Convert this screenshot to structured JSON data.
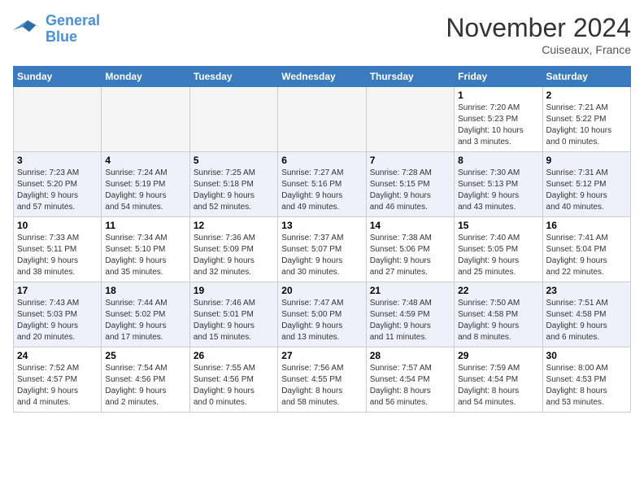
{
  "header": {
    "logo_line1": "General",
    "logo_line2": "Blue",
    "month": "November 2024",
    "location": "Cuiseaux, France"
  },
  "weekdays": [
    "Sunday",
    "Monday",
    "Tuesday",
    "Wednesday",
    "Thursday",
    "Friday",
    "Saturday"
  ],
  "weeks": [
    [
      {
        "day": "",
        "info": ""
      },
      {
        "day": "",
        "info": ""
      },
      {
        "day": "",
        "info": ""
      },
      {
        "day": "",
        "info": ""
      },
      {
        "day": "",
        "info": ""
      },
      {
        "day": "1",
        "info": "Sunrise: 7:20 AM\nSunset: 5:23 PM\nDaylight: 10 hours\nand 3 minutes."
      },
      {
        "day": "2",
        "info": "Sunrise: 7:21 AM\nSunset: 5:22 PM\nDaylight: 10 hours\nand 0 minutes."
      }
    ],
    [
      {
        "day": "3",
        "info": "Sunrise: 7:23 AM\nSunset: 5:20 PM\nDaylight: 9 hours\nand 57 minutes."
      },
      {
        "day": "4",
        "info": "Sunrise: 7:24 AM\nSunset: 5:19 PM\nDaylight: 9 hours\nand 54 minutes."
      },
      {
        "day": "5",
        "info": "Sunrise: 7:25 AM\nSunset: 5:18 PM\nDaylight: 9 hours\nand 52 minutes."
      },
      {
        "day": "6",
        "info": "Sunrise: 7:27 AM\nSunset: 5:16 PM\nDaylight: 9 hours\nand 49 minutes."
      },
      {
        "day": "7",
        "info": "Sunrise: 7:28 AM\nSunset: 5:15 PM\nDaylight: 9 hours\nand 46 minutes."
      },
      {
        "day": "8",
        "info": "Sunrise: 7:30 AM\nSunset: 5:13 PM\nDaylight: 9 hours\nand 43 minutes."
      },
      {
        "day": "9",
        "info": "Sunrise: 7:31 AM\nSunset: 5:12 PM\nDaylight: 9 hours\nand 40 minutes."
      }
    ],
    [
      {
        "day": "10",
        "info": "Sunrise: 7:33 AM\nSunset: 5:11 PM\nDaylight: 9 hours\nand 38 minutes."
      },
      {
        "day": "11",
        "info": "Sunrise: 7:34 AM\nSunset: 5:10 PM\nDaylight: 9 hours\nand 35 minutes."
      },
      {
        "day": "12",
        "info": "Sunrise: 7:36 AM\nSunset: 5:09 PM\nDaylight: 9 hours\nand 32 minutes."
      },
      {
        "day": "13",
        "info": "Sunrise: 7:37 AM\nSunset: 5:07 PM\nDaylight: 9 hours\nand 30 minutes."
      },
      {
        "day": "14",
        "info": "Sunrise: 7:38 AM\nSunset: 5:06 PM\nDaylight: 9 hours\nand 27 minutes."
      },
      {
        "day": "15",
        "info": "Sunrise: 7:40 AM\nSunset: 5:05 PM\nDaylight: 9 hours\nand 25 minutes."
      },
      {
        "day": "16",
        "info": "Sunrise: 7:41 AM\nSunset: 5:04 PM\nDaylight: 9 hours\nand 22 minutes."
      }
    ],
    [
      {
        "day": "17",
        "info": "Sunrise: 7:43 AM\nSunset: 5:03 PM\nDaylight: 9 hours\nand 20 minutes."
      },
      {
        "day": "18",
        "info": "Sunrise: 7:44 AM\nSunset: 5:02 PM\nDaylight: 9 hours\nand 17 minutes."
      },
      {
        "day": "19",
        "info": "Sunrise: 7:46 AM\nSunset: 5:01 PM\nDaylight: 9 hours\nand 15 minutes."
      },
      {
        "day": "20",
        "info": "Sunrise: 7:47 AM\nSunset: 5:00 PM\nDaylight: 9 hours\nand 13 minutes."
      },
      {
        "day": "21",
        "info": "Sunrise: 7:48 AM\nSunset: 4:59 PM\nDaylight: 9 hours\nand 11 minutes."
      },
      {
        "day": "22",
        "info": "Sunrise: 7:50 AM\nSunset: 4:58 PM\nDaylight: 9 hours\nand 8 minutes."
      },
      {
        "day": "23",
        "info": "Sunrise: 7:51 AM\nSunset: 4:58 PM\nDaylight: 9 hours\nand 6 minutes."
      }
    ],
    [
      {
        "day": "24",
        "info": "Sunrise: 7:52 AM\nSunset: 4:57 PM\nDaylight: 9 hours\nand 4 minutes."
      },
      {
        "day": "25",
        "info": "Sunrise: 7:54 AM\nSunset: 4:56 PM\nDaylight: 9 hours\nand 2 minutes."
      },
      {
        "day": "26",
        "info": "Sunrise: 7:55 AM\nSunset: 4:56 PM\nDaylight: 9 hours\nand 0 minutes."
      },
      {
        "day": "27",
        "info": "Sunrise: 7:56 AM\nSunset: 4:55 PM\nDaylight: 8 hours\nand 58 minutes."
      },
      {
        "day": "28",
        "info": "Sunrise: 7:57 AM\nSunset: 4:54 PM\nDaylight: 8 hours\nand 56 minutes."
      },
      {
        "day": "29",
        "info": "Sunrise: 7:59 AM\nSunset: 4:54 PM\nDaylight: 8 hours\nand 54 minutes."
      },
      {
        "day": "30",
        "info": "Sunrise: 8:00 AM\nSunset: 4:53 PM\nDaylight: 8 hours\nand 53 minutes."
      }
    ]
  ]
}
